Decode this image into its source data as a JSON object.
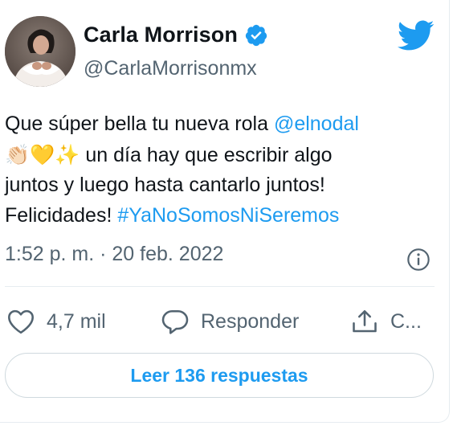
{
  "author": {
    "name": "Carla Morrison",
    "handle": "@CarlaMorrisonmx"
  },
  "tweet": {
    "line1_text": "Que súper bella tu nueva rola ",
    "mention": "@elnodal",
    "emoji_clap": "👏🏻",
    "emoji_heart": "💛",
    "emoji_sparkles": "✨",
    "line2_text": " un día hay que escribir algo",
    "line3_text": "juntos y luego hasta cantarlo juntos!",
    "line4_text": "Felicidades! ",
    "hashtag": "#YaNoSomosNiSeremos"
  },
  "meta": {
    "timestamp": "1:52 p. m. · 20 feb. 2022"
  },
  "actions": {
    "likes": "4,7 mil",
    "reply_label": "Responder",
    "share_label": "C..."
  },
  "read_replies_label": "Leer 136 respuestas",
  "colors": {
    "accent": "#1d9bf0",
    "secondary_text": "#536471",
    "border": "#cfd9de"
  },
  "icons": [
    "avatar-photo",
    "verified-badge-icon",
    "twitter-bird-icon",
    "info-icon",
    "heart-icon",
    "reply-bubble-icon",
    "share-icon"
  ]
}
